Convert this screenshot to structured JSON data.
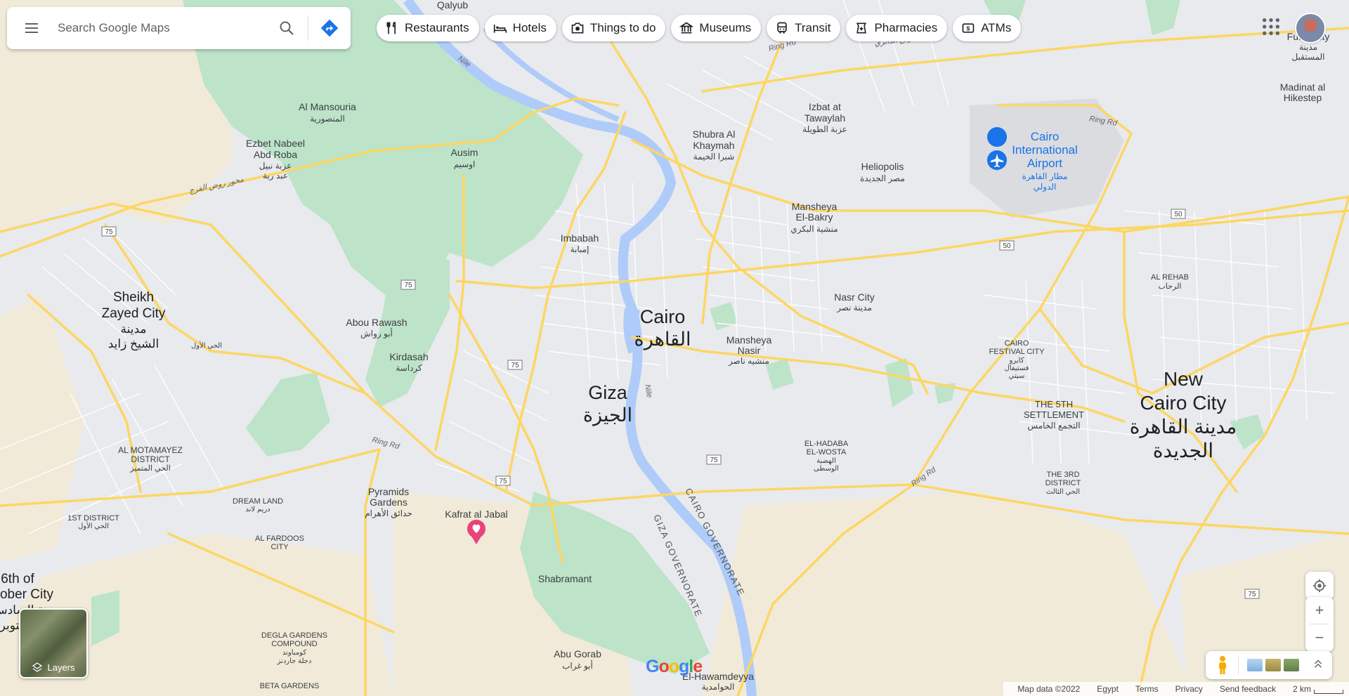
{
  "search": {
    "placeholder": "Search Google Maps"
  },
  "chips": [
    {
      "label": "Restaurants",
      "icon": "restaurant-icon"
    },
    {
      "label": "Hotels",
      "icon": "hotel-icon"
    },
    {
      "label": "Things to do",
      "icon": "camera-icon"
    },
    {
      "label": "Museums",
      "icon": "museum-icon"
    },
    {
      "label": "Transit",
      "icon": "train-icon"
    },
    {
      "label": "Pharmacies",
      "icon": "pharmacy-icon"
    },
    {
      "label": "ATMs",
      "icon": "atm-icon"
    }
  ],
  "layers": {
    "label": "Layers"
  },
  "zoom": {
    "in": "+",
    "out": "−"
  },
  "brand": {
    "logo": "Google"
  },
  "attribution": {
    "map_data": "Map data ©2022",
    "region": "Egypt",
    "terms": "Terms",
    "privacy": "Privacy",
    "feedback": "Send feedback",
    "scale": "2 km"
  },
  "colors": {
    "water": "#aecbfa",
    "park": "#bde3c9",
    "road": "#fdd663",
    "desert": "#f1ead8",
    "land": "#e8eaed"
  },
  "map": {
    "major_places": {
      "cairo": {
        "en": "Cairo",
        "ar": "القاهرة"
      },
      "giza": {
        "en": "Giza",
        "ar": "الجيزة"
      },
      "new_cairo": {
        "en1": "New",
        "en2": "Cairo City",
        "ar1": "مدينة القاهرة",
        "ar2": "الجديدة"
      },
      "sheikh_zayed": {
        "en1": "Sheikh",
        "en2": "Zayed City",
        "ar1": "مدينة",
        "ar2": "الشيخ زايد"
      },
      "october": {
        "en1": "6th of",
        "en2": "ober City",
        "ar1": "مدينة السادس",
        "ar2": "أكتوبر"
      }
    },
    "places": {
      "qalyub": "Qalyub",
      "al_mansouria": {
        "en": "Al Mansouria",
        "ar": "المنصورية"
      },
      "ezbet": {
        "en1": "Ezbet Nabeel",
        "en2": "Abd Roba",
        "ar1": "عزبة نبيل",
        "ar2": "عبد ربة"
      },
      "ausim": {
        "en": "Ausim",
        "ar": "اوسيم"
      },
      "shubra": {
        "en1": "Shubra Al",
        "en2": "Khaymah",
        "ar": "شبرا الخيمة"
      },
      "izbat": {
        "en1": "Izbat at",
        "en2": "Tawaylah",
        "ar": "عزبة الطويلة"
      },
      "heliopolis": {
        "en": "Heliopolis",
        "ar": "مصر الجديدة"
      },
      "airport": {
        "en1": "Cairo",
        "en2": "International",
        "en3": "Airport",
        "ar1": "مطار القاهرة",
        "ar2": "الدولي"
      },
      "future": {
        "en": "Futur City",
        "ar1": "مدينة",
        "ar2": "المستقبل"
      },
      "madinat": {
        "en1": "Madinat al",
        "en2": "Hikestep"
      },
      "imbabah": {
        "en": "Imbabah",
        "ar": "إمبابة"
      },
      "mansheya_bakry": {
        "en1": "Mansheya",
        "en2": "El-Bakry",
        "ar": "منشية البكري"
      },
      "nasr": {
        "en": "Nasr City",
        "ar": "مدينة نصر"
      },
      "al_rehab": {
        "en": "AL REHAB",
        "ar": "الرحاب"
      },
      "abou_rawash": {
        "en": "Abou Rawash",
        "ar": "أبو رواش"
      },
      "kirdasah": {
        "en": "Kirdasah",
        "ar": "كرداسة"
      },
      "mansheya_nasir": {
        "en1": "Mansheya",
        "en2": "Nasir",
        "ar": "منشيه ناصر"
      },
      "festival": {
        "en1": "CAIRO",
        "en2": "FESTIVAL CITY",
        "ar1": "كايرو",
        "ar2": "فستيفال",
        "ar3": "سيتي"
      },
      "fifth": {
        "en1": "THE 5TH",
        "en2": "SETTLEMENT",
        "ar": "التجمع الخامس"
      },
      "motamayez": {
        "en1": "AL MOTAMAYEZ",
        "en2": "DISTRICT",
        "ar": "الحي المتميز"
      },
      "hadaba": {
        "en1": "EL-HADABA",
        "en2": "EL-WOSTA",
        "ar1": "الهضبة",
        "ar2": "الوسطى"
      },
      "third": {
        "en1": "THE 3RD",
        "en2": "DISTRICT",
        "ar": "الحي الثالث"
      },
      "pyramids": {
        "en1": "Pyramids",
        "en2": "Gardens",
        "ar": "حدائق الأهرام"
      },
      "kafrat": "Kafrat al Jabal",
      "dream": {
        "en": "DREAM LAND",
        "ar": "دريم لاند"
      },
      "first": {
        "en": "1ST DISTRICT",
        "ar": "الحي الأول"
      },
      "fardoos": {
        "en1": "AL FARDOOS",
        "en2": "CITY"
      },
      "shabramant": "Shabramant",
      "degla": {
        "en1": "DEGLA GARDENS",
        "en2": "COMPOUND",
        "ar1": "كومباوند",
        "ar2": "دجلة جاردنز"
      },
      "abu_gorab": {
        "en": "Abu Gorab",
        "ar": "أبو غراب"
      },
      "hawamdeyya": {
        "en": "El-Hawamdeyya",
        "ar": "الحوامدية"
      },
      "beta": "BETA GARDENS",
      "al_hay": "الحي الأول"
    },
    "roads": {
      "ring": "Ring Rd",
      "ring_ar": "الطريق الدائري",
      "mehwar": "محور روض الفرج",
      "nile": "Nile",
      "r75": "75",
      "r50": "50",
      "cairo_gov": "CAIRO GOVERNORATE",
      "giza_gov": "GIZA GOVERNORATE"
    }
  }
}
